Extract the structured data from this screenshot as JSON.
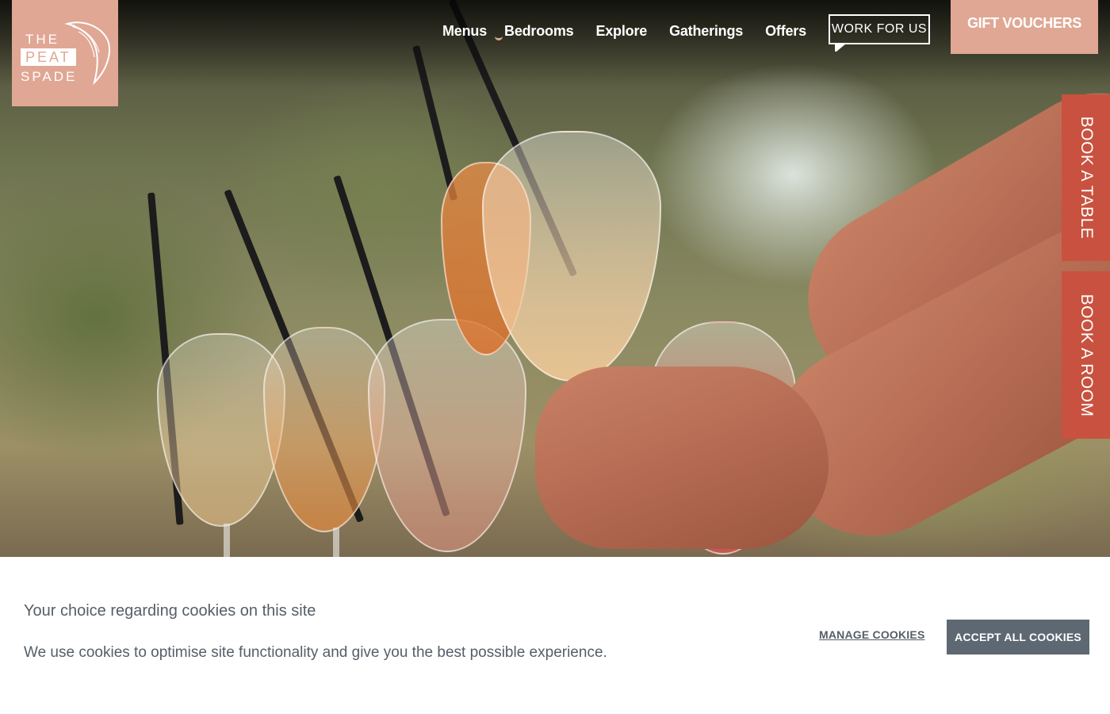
{
  "logo": {
    "line1": "THE",
    "line2": "PEAT",
    "line3": "SPADE",
    "icon": "fish-icon"
  },
  "nav": {
    "items": [
      {
        "label": "Menus",
        "has_dropdown": true
      },
      {
        "label": "Bedrooms"
      },
      {
        "label": "Explore"
      },
      {
        "label": "Gatherings"
      },
      {
        "label": "Offers"
      }
    ],
    "work_for_us": "WORK FOR US",
    "gift_vouchers": "GIFT VOUCHERS"
  },
  "side_tabs": {
    "book_table": "BOOK A TABLE",
    "book_room": "BOOK A ROOM"
  },
  "cookie_banner": {
    "title": "Your choice regarding cookies on this site",
    "text": "We use cookies to optimise site functionality and give you the best possible experience.",
    "manage_label": "MANAGE COOKIES",
    "accept_label": "ACCEPT ALL COOKIES"
  },
  "colors": {
    "brand_pink": "#e0a794",
    "side_tab_red": "#c8523f",
    "accept_button": "#5d6872",
    "banner_text": "#555e68"
  }
}
